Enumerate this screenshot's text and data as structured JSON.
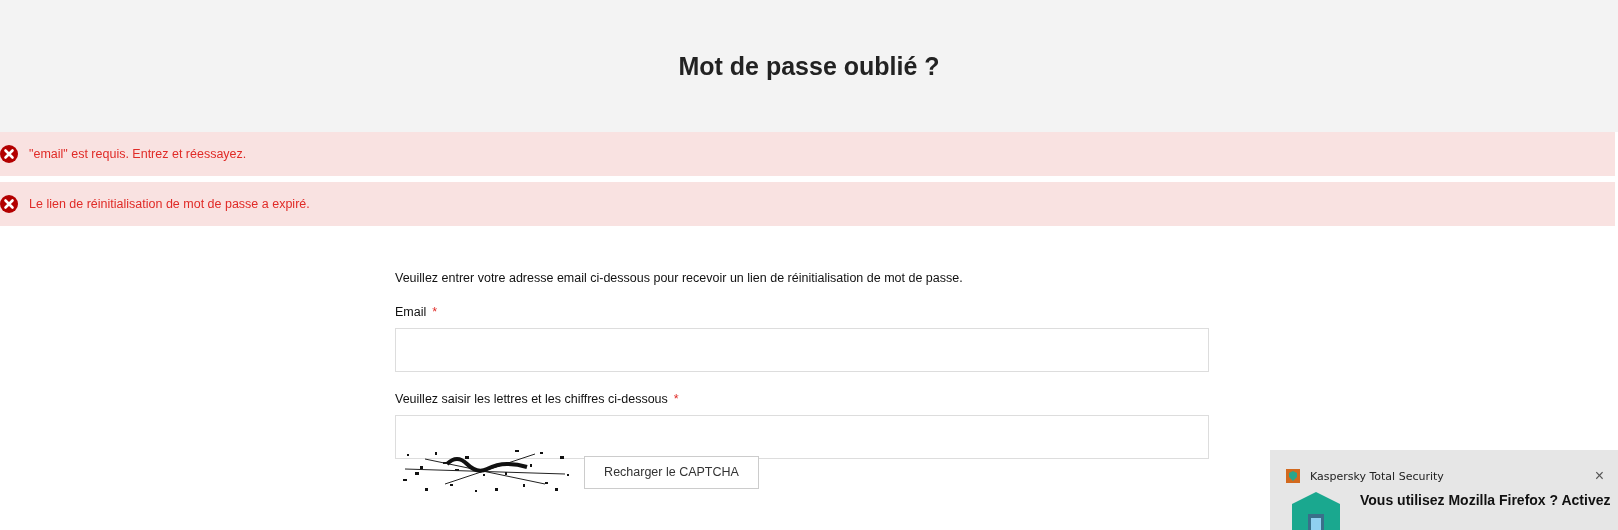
{
  "page_title": "Mot de passe oublié ?",
  "errors": [
    {
      "text": "\"email\" est requis. Entrez et réessayez."
    },
    {
      "text": "Le lien de réinitialisation de mot de passe a expiré."
    }
  ],
  "form": {
    "intro": "Veuillez entrer votre adresse email ci-dessous pour recevoir un lien de réinitialisation de mot de passe.",
    "fields": [
      {
        "label": "Email",
        "required_mark": "*"
      },
      {
        "label": "Veuillez saisir les lettres et les chiffres ci-dessous",
        "required_mark": "*"
      }
    ],
    "captcha": {
      "kind": "picture",
      "reload_button": "Recharger le CAPTCHA"
    }
  },
  "notification": {
    "app": "Kaspersky Total Security",
    "close": "×",
    "heading": "Vous utilisez Mozilla Firefox ? Activez"
  }
}
